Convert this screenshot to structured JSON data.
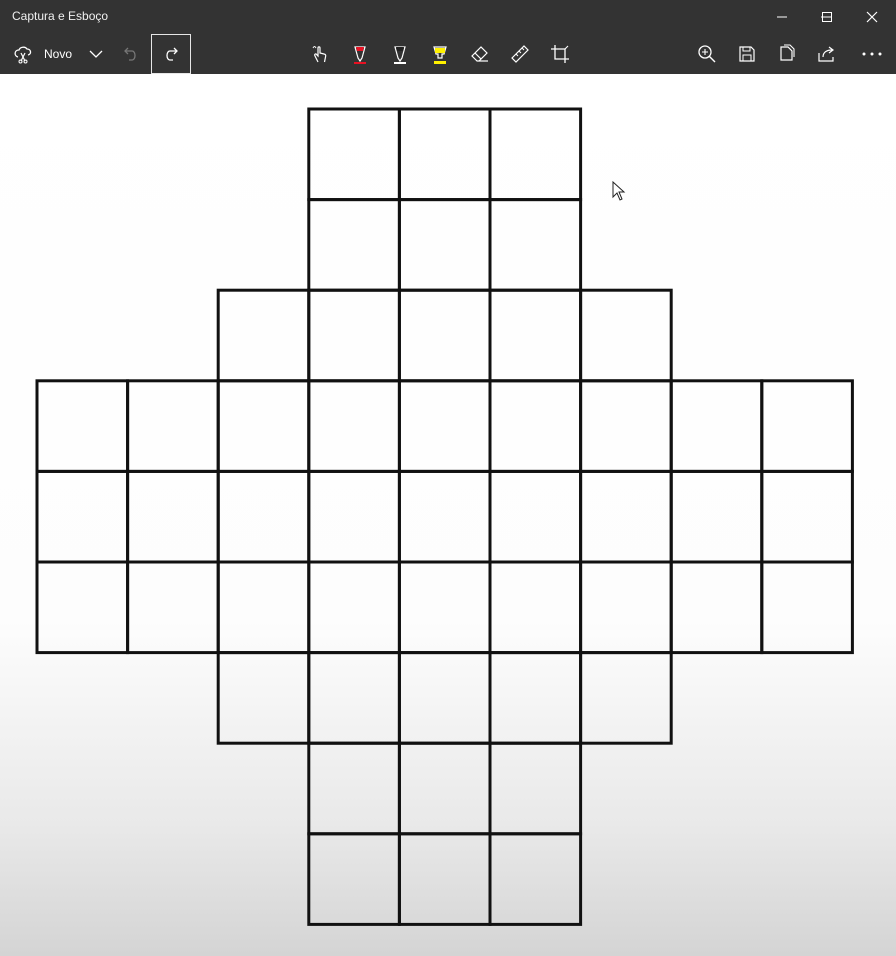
{
  "window": {
    "title": "Captura e Esboço",
    "controls": {
      "minimize": "minimize-icon",
      "maximize": "maximize-icon",
      "close": "close-icon"
    }
  },
  "toolbar": {
    "new_label": "Novo",
    "left_icons": [
      "new-snip-icon",
      "chevron-down-icon",
      "undo-icon",
      "redo-icon"
    ],
    "center_icons": [
      "touch-writing-icon",
      "ballpoint-pen-icon",
      "pencil-icon",
      "highlighter-icon",
      "eraser-icon",
      "ruler-icon",
      "crop-icon"
    ],
    "right_icons": [
      "zoom-icon",
      "save-icon",
      "copy-icon",
      "share-icon",
      "more-icon"
    ],
    "pen_colors": {
      "ballpoint": "#e81123",
      "pencil": "#ffffff",
      "highlighter": "#fff100"
    }
  },
  "drawing": {
    "description_colors": {
      "line": "#111111"
    },
    "grid_rows": [
      {
        "from_col": 3,
        "to_col": 5
      },
      {
        "from_col": 3,
        "to_col": 5
      },
      {
        "from_col": 2,
        "to_col": 6
      },
      {
        "from_col": 0,
        "to_col": 8
      },
      {
        "from_col": 0,
        "to_col": 8
      },
      {
        "from_col": 0,
        "to_col": 8
      },
      {
        "from_col": 2,
        "to_col": 6
      },
      {
        "from_col": 3,
        "to_col": 5
      },
      {
        "from_col": 3,
        "to_col": 5
      }
    ]
  }
}
